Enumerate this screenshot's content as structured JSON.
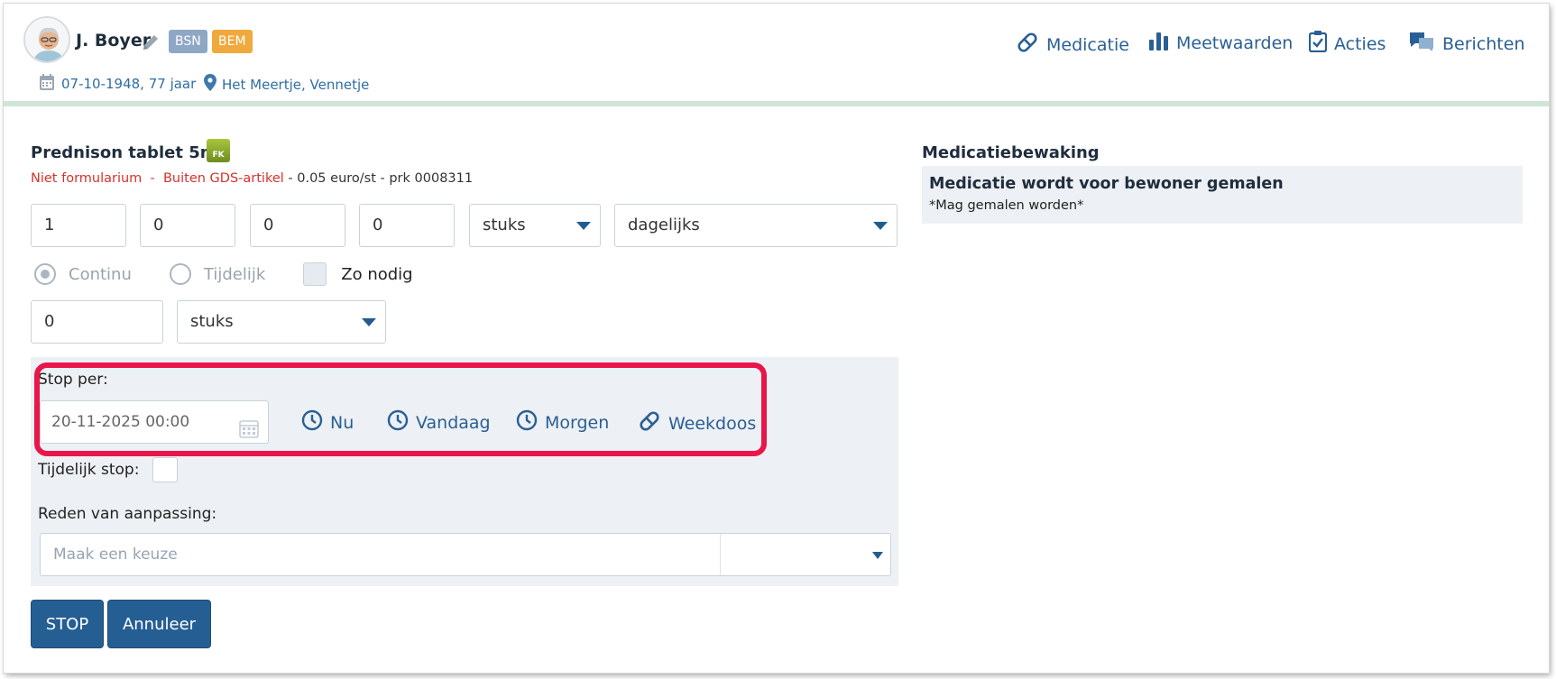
{
  "patient": {
    "name": "J. Boyer",
    "badges": [
      "BSN",
      "BEM"
    ],
    "dob": "07-10-1948, 77 jaar",
    "location": "Het Meertje, Vennetje"
  },
  "nav": {
    "medicatie": "Medicatie",
    "meetwaarden": "Meetwaarden",
    "acties": "Acties",
    "berichten": "Berichten"
  },
  "drug": {
    "name": "Prednison tablet 5mg",
    "fk_label": "FK",
    "niet_formularium": "Niet formularium",
    "separator": "-",
    "buiten_gds": "Buiten GDS-artikel",
    "price": "- 0.05 euro/st - prk 0008311"
  },
  "dosage": {
    "fields": [
      "1",
      "0",
      "0",
      "0"
    ],
    "unit": "stuks",
    "frequency": "dagelijks"
  },
  "mode": {
    "continu": "Continu",
    "tijdelijk": "Tijdelijk",
    "zo_nodig": "Zo nodig",
    "selected": "Continu"
  },
  "extra": {
    "quantity": "0",
    "unit": "stuks"
  },
  "stop": {
    "label": "Stop per:",
    "date_value": "20-11-2025 00:00",
    "quick": [
      "Nu",
      "Vandaag",
      "Morgen",
      "Weekdoos"
    ],
    "tijdelijk_label": "Tijdelijk stop:",
    "reden_label": "Reden van aanpassing:",
    "reden_placeholder": "Maak een keuze"
  },
  "buttons": {
    "stop": "STOP",
    "annuleer": "Annuleer"
  },
  "bewaking": {
    "title": "Medicatiebewaking",
    "line1": "Medicatie wordt voor bewoner gemalen",
    "line2": "*Mag gemalen worden*"
  },
  "colors": {
    "accent": "#255e93",
    "link": "#2a5f95",
    "highlight": "#e8164a",
    "warning": "#d3332b"
  }
}
